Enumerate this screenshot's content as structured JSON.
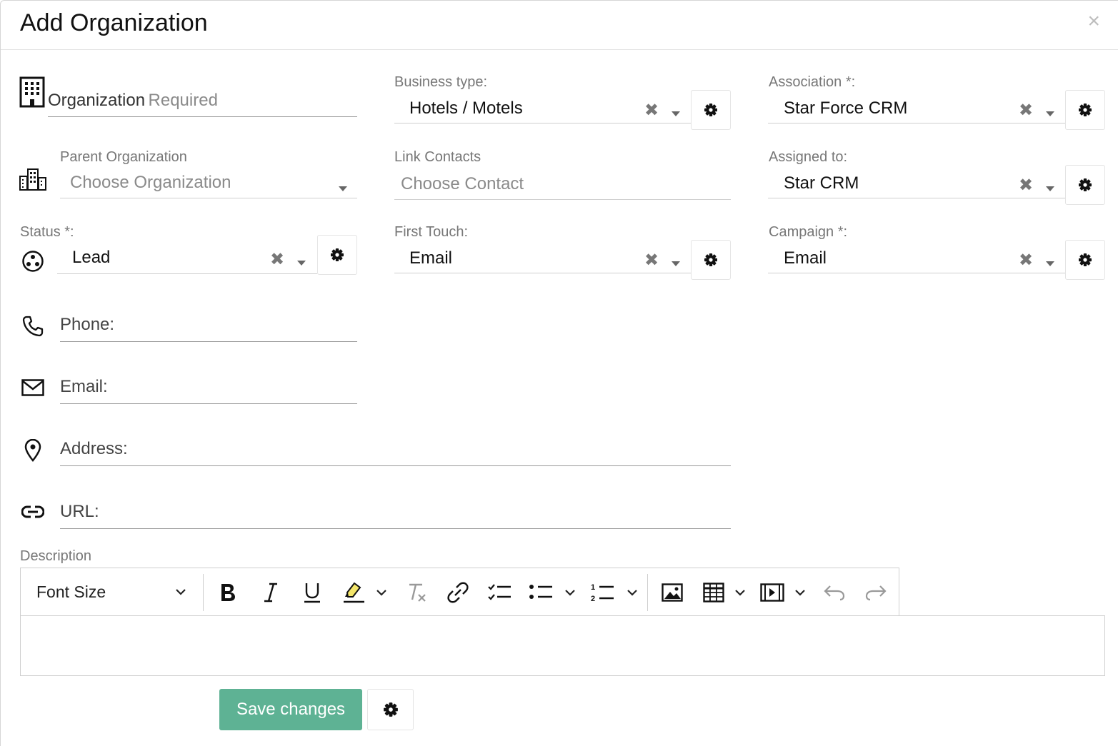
{
  "modal": {
    "title": "Add Organization",
    "close_glyph": "×"
  },
  "organization": {
    "label": "Organization",
    "required_text": "Required"
  },
  "business_type": {
    "label": "Business type:",
    "value": "Hotels / Motels"
  },
  "association": {
    "label": "Association *:",
    "value": "Star Force CRM"
  },
  "parent_organization": {
    "label": "Parent Organization",
    "placeholder": "Choose Organization"
  },
  "link_contacts": {
    "label": "Link Contacts",
    "placeholder": "Choose Contact"
  },
  "assigned_to": {
    "label": "Assigned to:",
    "value": "Star CRM"
  },
  "status": {
    "label": "Status *:",
    "value": "Lead"
  },
  "first_touch": {
    "label": "First Touch:",
    "value": "Email"
  },
  "campaign": {
    "label": "Campaign *:",
    "value": "Email"
  },
  "phone": {
    "label": "Phone:"
  },
  "email": {
    "label": "Email:"
  },
  "address": {
    "label": "Address:"
  },
  "url": {
    "label": "URL:"
  },
  "description": {
    "label": "Description",
    "font_size_label": "Font Size"
  },
  "clear_glyph": "✖",
  "save_button_label": "Save changes",
  "colors": {
    "save_button": "#5eb294",
    "label_gray": "#777777",
    "border": "#cfcfcf"
  }
}
